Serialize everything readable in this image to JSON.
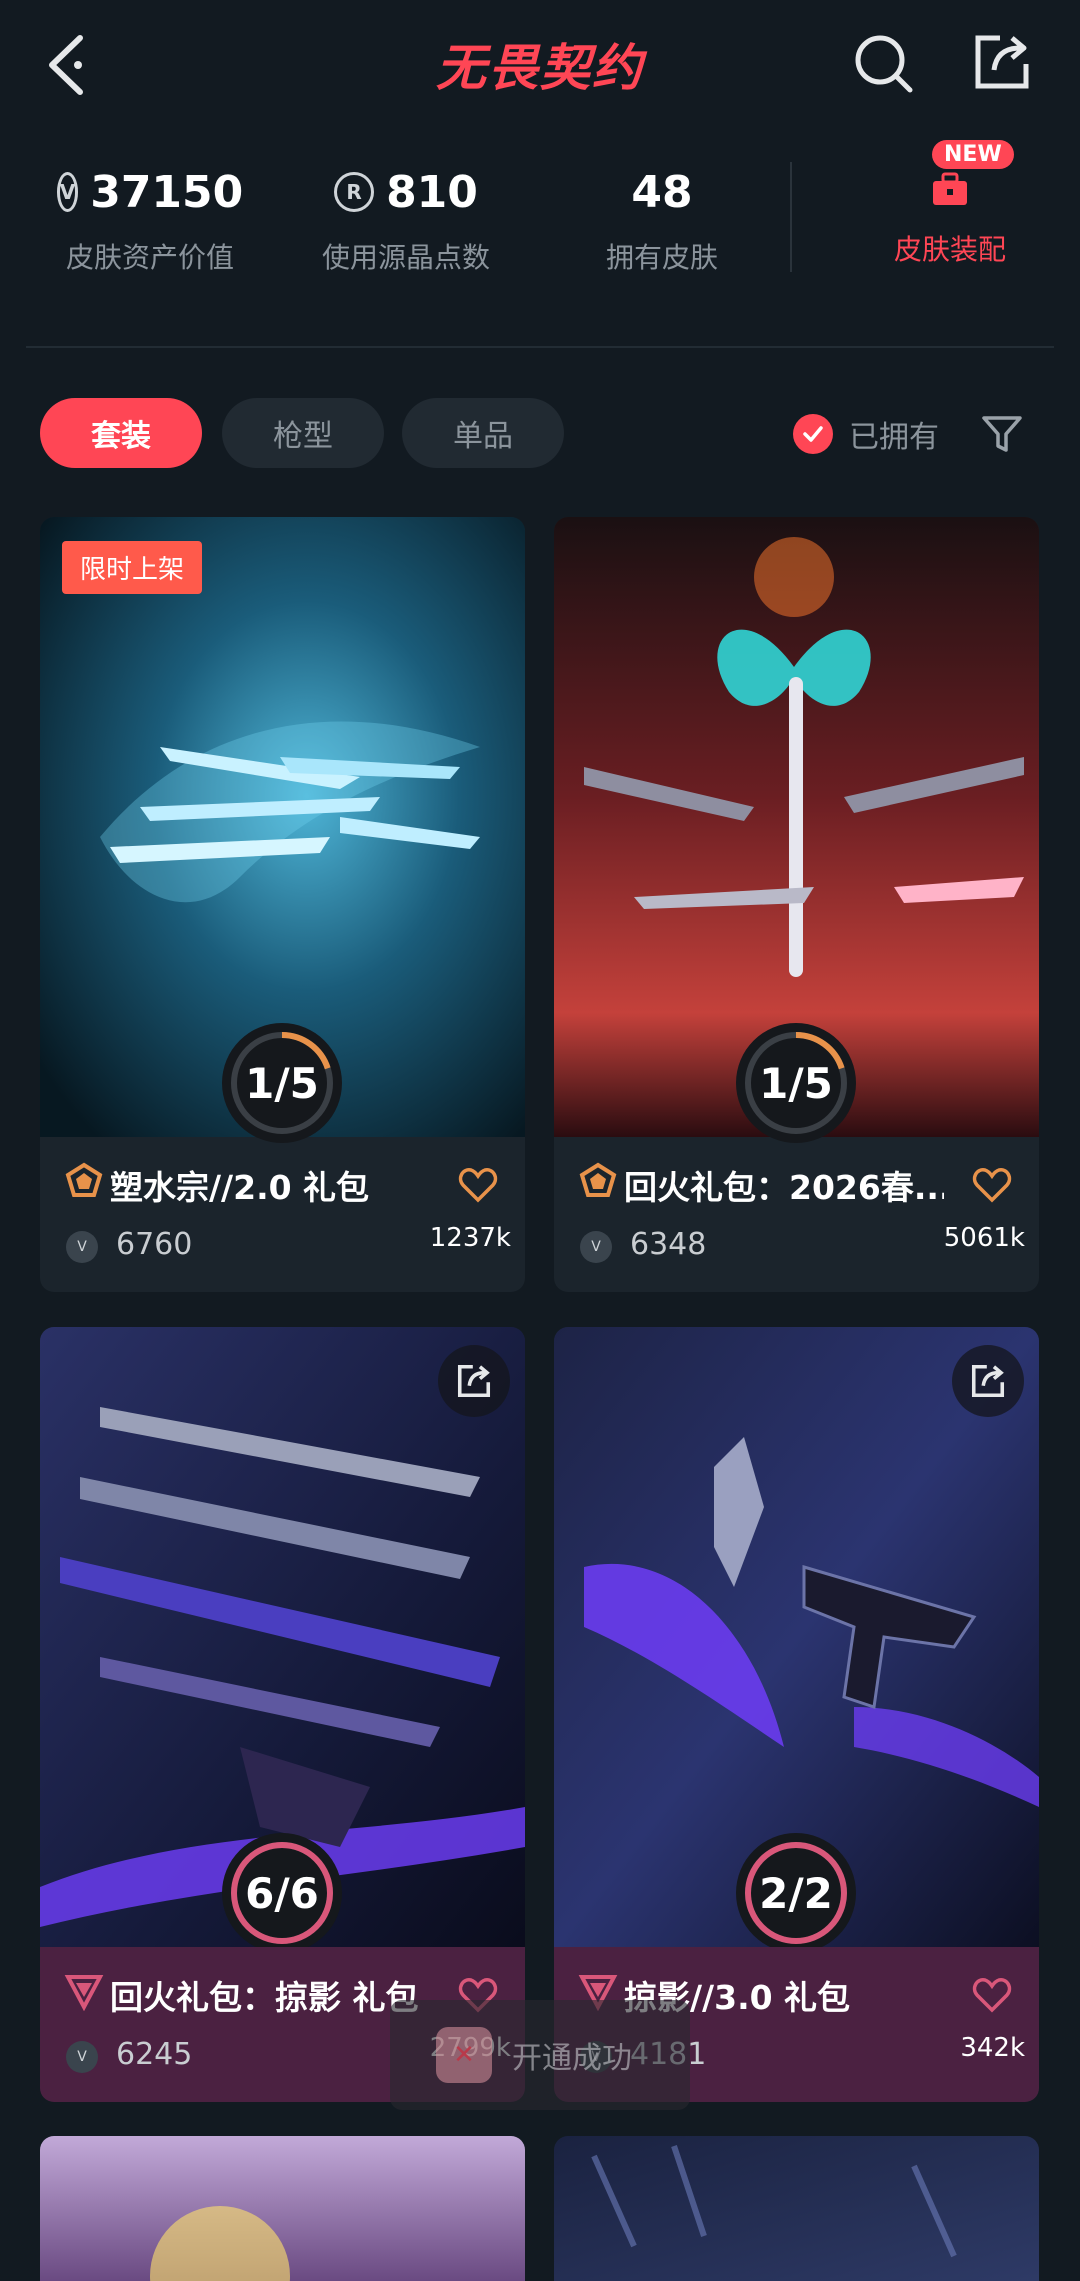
{
  "header": {
    "title": "无畏契约"
  },
  "stats": {
    "asset_value": "37150",
    "asset_label": "皮肤资产价值",
    "points": "810",
    "points_label": "使用源晶点数",
    "owned_count": "48",
    "owned_label": "拥有皮肤",
    "equip_label": "皮肤装配",
    "new_badge": "NEW"
  },
  "tabs": [
    {
      "label": "套装",
      "active": true
    },
    {
      "label": "枪型",
      "active": false
    },
    {
      "label": "单品",
      "active": false
    }
  ],
  "filter": {
    "owned_label": "已拥有"
  },
  "cards": [
    {
      "badge": "限时上架",
      "progress": "1/5",
      "progress_fraction": 0.2,
      "title": "塑水宗//2.0 礼包",
      "price": "6760",
      "likes": "1237k",
      "tier": "premium"
    },
    {
      "progress": "1/5",
      "progress_fraction": 0.2,
      "title": "回火礼包：2026春...",
      "price": "6348",
      "likes": "5061k",
      "tier": "premium"
    },
    {
      "progress": "6/6",
      "progress_fraction": 1.0,
      "title": "回火礼包：掠影 礼包",
      "price": "6245",
      "likes": "2799k",
      "tier": "exclusive"
    },
    {
      "progress": "2/2",
      "progress_fraction": 1.0,
      "title": "掠影//3.0 礼包",
      "price": "4181",
      "likes": "342k",
      "tier": "exclusive"
    }
  ],
  "toast": {
    "text": "开通成功"
  },
  "colors": {
    "accent": "#ff4655",
    "bg": "#121a21",
    "premium": "#e8924a",
    "exclusive": "#d9577a"
  }
}
